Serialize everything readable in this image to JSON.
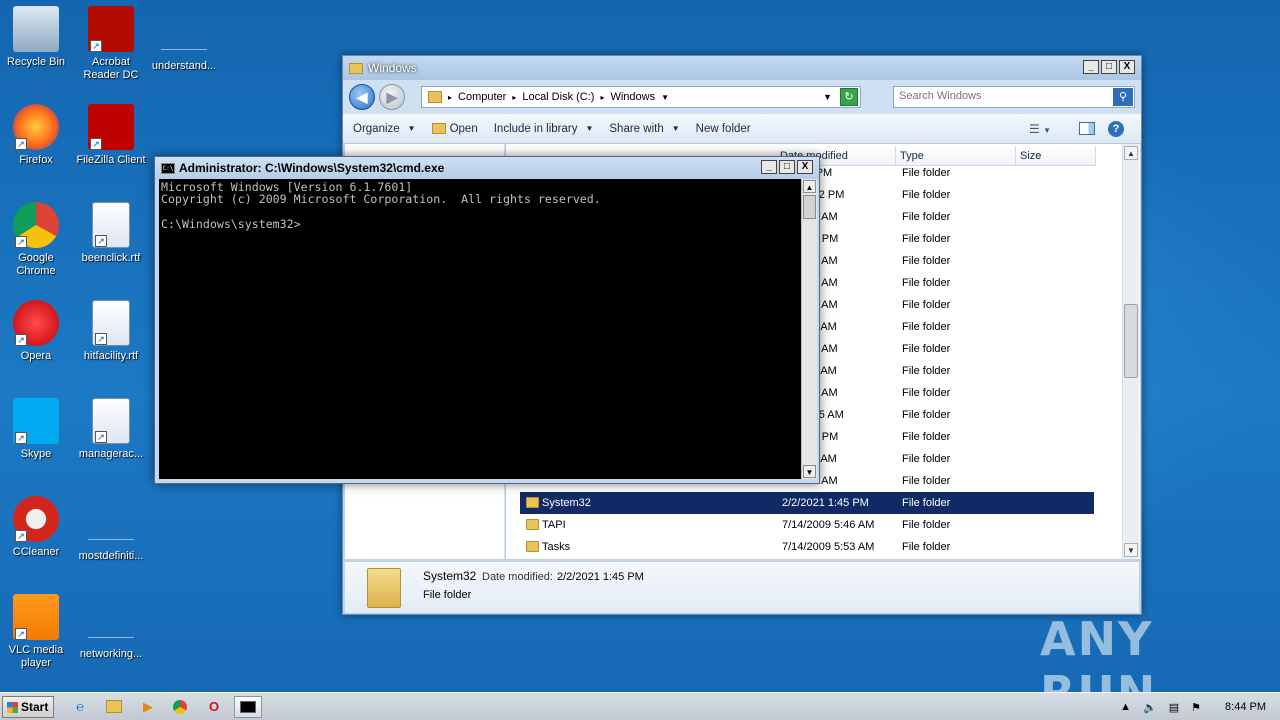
{
  "desktop": {
    "icons": [
      {
        "label": "Recycle Bin",
        "icon": "recycle-bin-icon"
      },
      {
        "label": "Acrobat Reader DC",
        "icon": "acrobat-icon"
      },
      {
        "label": "understand...",
        "icon": "blank-file-icon"
      },
      {
        "label": "Firefox",
        "icon": "firefox-icon"
      },
      {
        "label": "FileZilla Client",
        "icon": "filezilla-icon"
      },
      {
        "label": "Google Chrome",
        "icon": "chrome-icon"
      },
      {
        "label": "beenclick.rtf",
        "icon": "word-doc-icon"
      },
      {
        "label": "Opera",
        "icon": "opera-icon"
      },
      {
        "label": "hitfacility.rtf",
        "icon": "word-doc-icon"
      },
      {
        "label": "Skype",
        "icon": "skype-icon"
      },
      {
        "label": "managerac...",
        "icon": "word-doc-icon"
      },
      {
        "label": "CCleaner",
        "icon": "ccleaner-icon"
      },
      {
        "label": "mostdefiniti...",
        "icon": "blank-file-icon"
      },
      {
        "label": "VLC media player",
        "icon": "vlc-icon"
      },
      {
        "label": "networking...",
        "icon": "blank-file-icon"
      }
    ],
    "watermark": "ANY RUN"
  },
  "explorer": {
    "title": "Windows",
    "controls": {
      "minimize": "_",
      "maximize": "□",
      "close": "X"
    },
    "breadcrumb": [
      "Computer",
      "Local Disk (C:)",
      "Windows"
    ],
    "search_placeholder": "Search Windows",
    "toolbar": {
      "organize": "Organize",
      "open": "Open",
      "include_in_library": "Include in library",
      "share_with": "Share with",
      "new_folder": "New folder"
    },
    "columns": {
      "date": "Date modified",
      "type": "Type",
      "size": "Size"
    },
    "rows": [
      {
        "name": "",
        "date": "8 1:20 PM",
        "type": "File folder"
      },
      {
        "name": "",
        "date": "18 12:22 PM",
        "type": "File folder"
      },
      {
        "name": "",
        "date": "09 3:37 AM",
        "type": "File folder"
      },
      {
        "name": "",
        "date": "17 6:19 PM",
        "type": "File folder"
      },
      {
        "name": "",
        "date": "09 5:52 AM",
        "type": "File folder"
      },
      {
        "name": "",
        "date": "09 3:05 AM",
        "type": "File folder"
      },
      {
        "name": "",
        "date": "09 5:52 AM",
        "type": "File folder"
      },
      {
        "name": "",
        "date": "11 3:24 AM",
        "type": "File folder"
      },
      {
        "name": "",
        "date": "09 5:34 AM",
        "type": "File folder"
      },
      {
        "name": "",
        "date": "11 3:16 AM",
        "type": "File folder"
      },
      {
        "name": "",
        "date": "09 5:34 AM",
        "type": "File folder"
      },
      {
        "name": "",
        "date": "19 10:45 AM",
        "type": "File folder"
      },
      {
        "name": "",
        "date": "18 2:17 PM",
        "type": "File folder"
      },
      {
        "name": "",
        "date": "11 3:16 AM",
        "type": "File folder"
      },
      {
        "name": "",
        "date": "09 5:52 AM",
        "type": "File folder"
      },
      {
        "name": "System32",
        "date": "2/2/2021 1:45 PM",
        "type": "File folder"
      },
      {
        "name": "TAPI",
        "date": "7/14/2009 5:46 AM",
        "type": "File folder"
      },
      {
        "name": "Tasks",
        "date": "7/14/2009 5:53 AM",
        "type": "File folder"
      }
    ],
    "selected_row": 15,
    "details": {
      "name": "System32",
      "date_label": "Date modified:",
      "date_value": "2/2/2021 1:45 PM",
      "type": "File folder"
    }
  },
  "cmd": {
    "title": "Administrator: C:\\Windows\\System32\\cmd.exe",
    "icon_text": "C:\\",
    "lines": [
      "Microsoft Windows [Version 6.1.7601]",
      "Copyright (c) 2009 Microsoft Corporation.  All rights reserved.",
      "",
      "C:\\Windows\\system32>"
    ]
  },
  "taskbar": {
    "start_label": "Start",
    "clock": "8:44 PM",
    "items": [
      "ie-icon",
      "explorer-icon",
      "media-player-icon",
      "chrome-icon",
      "opera-icon",
      "cmd-icon"
    ]
  }
}
